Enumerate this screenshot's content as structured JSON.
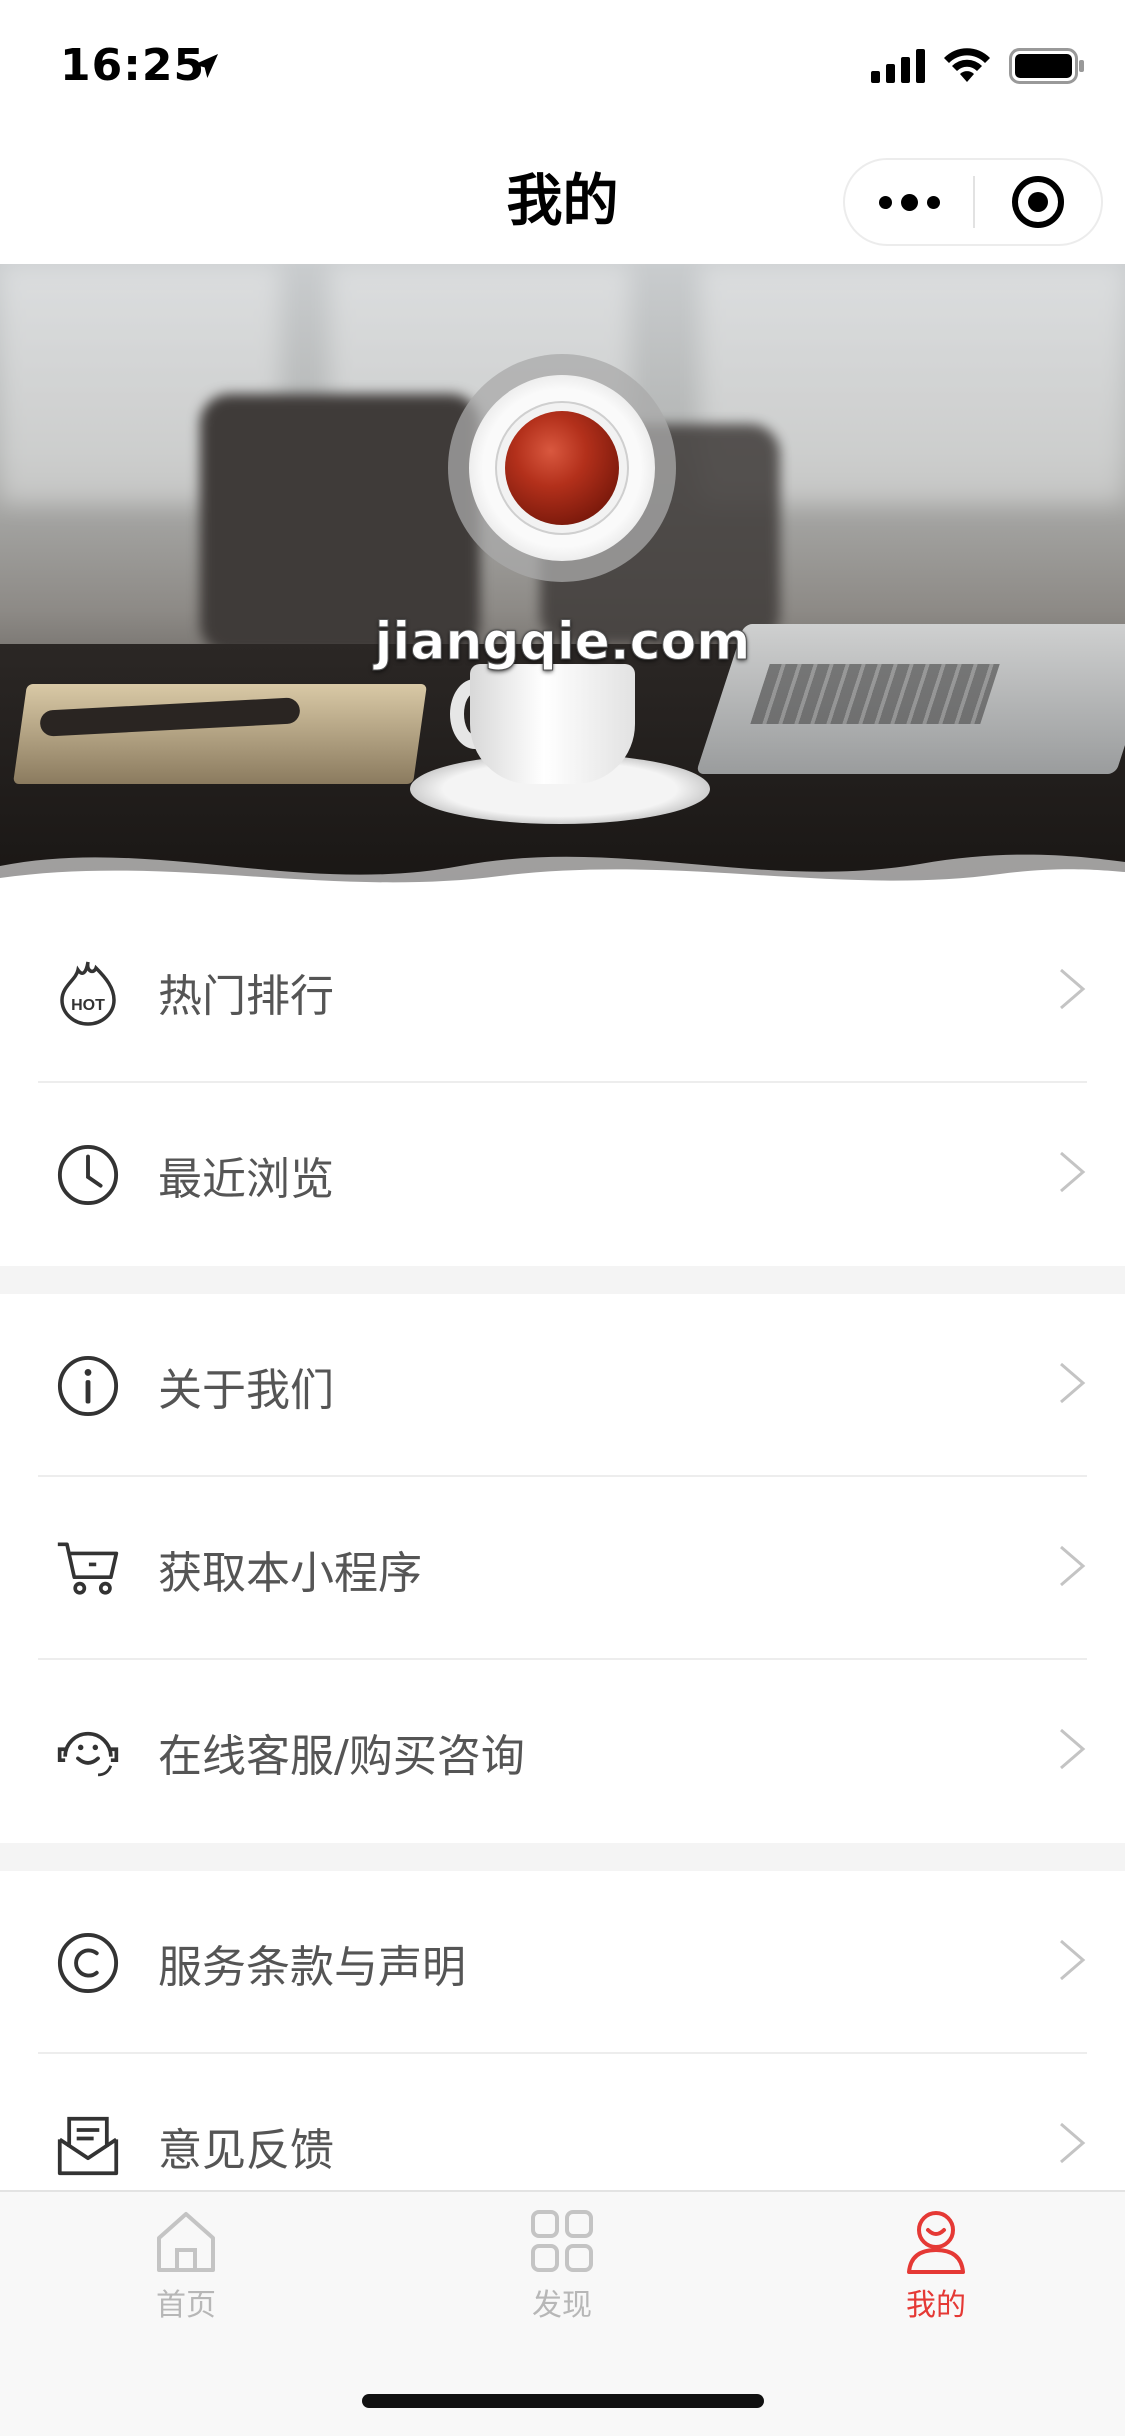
{
  "status_bar": {
    "time": "16:25",
    "location_icon": "location-arrow-icon",
    "signal_icon": "cellular-signal-icon",
    "wifi_icon": "wifi-icon",
    "battery_icon": "battery-icon"
  },
  "nav": {
    "title": "我的",
    "more_icon": "more-dots-icon",
    "close_icon": "target-close-icon"
  },
  "profile": {
    "site_name": "jiangqie.com",
    "avatar_icon": "tea-cup-avatar"
  },
  "menu_groups": [
    {
      "items": [
        {
          "label": "热门排行",
          "icon": "hot-flame-icon"
        },
        {
          "label": "最近浏览",
          "icon": "clock-icon"
        }
      ]
    },
    {
      "items": [
        {
          "label": "关于我们",
          "icon": "info-icon"
        },
        {
          "label": "获取本小程序",
          "icon": "cart-icon"
        },
        {
          "label": "在线客服/购买咨询",
          "icon": "customer-service-icon"
        }
      ]
    },
    {
      "items": [
        {
          "label": "服务条款与声明",
          "icon": "copyright-icon"
        },
        {
          "label": "意见反馈",
          "icon": "feedback-mail-icon"
        }
      ]
    }
  ],
  "tabs": [
    {
      "label": "首页",
      "icon": "home-icon",
      "active": false
    },
    {
      "label": "发现",
      "icon": "grid-icon",
      "active": false
    },
    {
      "label": "我的",
      "icon": "user-icon",
      "active": true
    }
  ],
  "colors": {
    "accent": "#e53935",
    "tab_inactive": "#b7b7b7",
    "text": "#555555",
    "gap": "#f4f4f4"
  }
}
